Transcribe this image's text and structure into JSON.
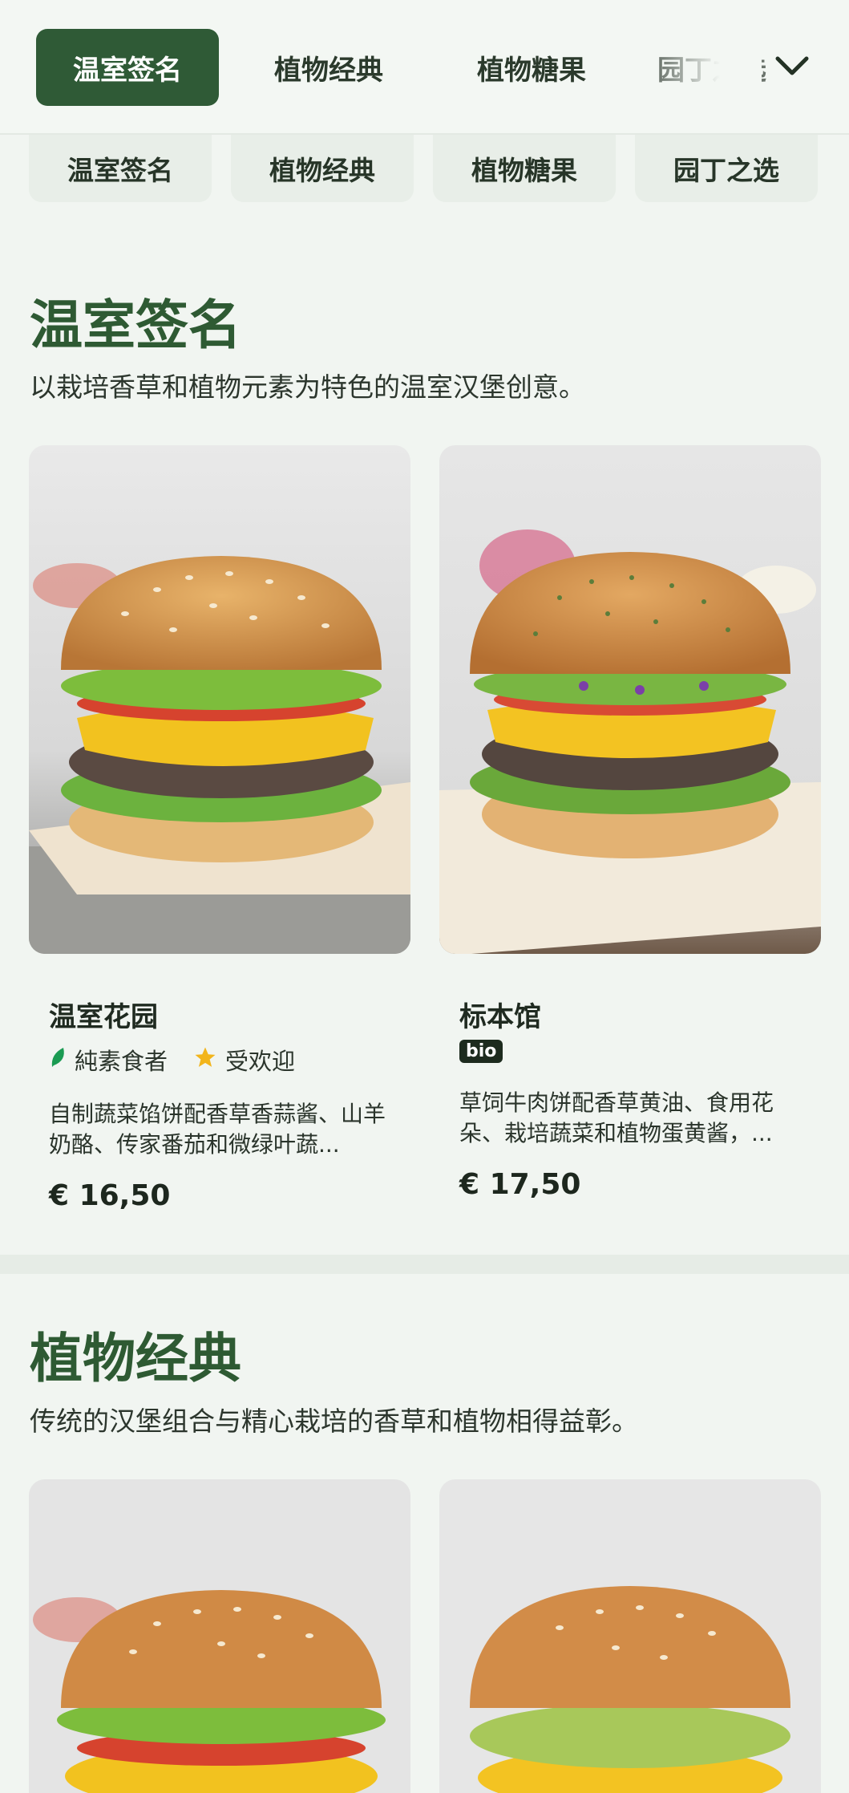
{
  "nav": {
    "tabs": [
      {
        "label": "温室签名",
        "active": true
      },
      {
        "label": "植物经典",
        "active": false
      },
      {
        "label": "植物糖果",
        "active": false
      },
      {
        "label": "园丁之选",
        "active": false
      }
    ],
    "expand_icon": "chevron-down-icon"
  },
  "chips": [
    "温室签名",
    "植物经典",
    "植物糖果",
    "园丁之选"
  ],
  "sections": [
    {
      "title": "温室签名",
      "description": "以栽培香草和植物元素为特色的温室汉堡创意。",
      "items": [
        {
          "name": "温室花园",
          "tags": [
            "純素食者",
            "受欢迎"
          ],
          "description": "自制蔬菜馅饼配香草香蒜酱、山羊奶酪、传家番茄和微绿叶蔬...",
          "price": "€ 16,50"
        },
        {
          "name": "标本馆",
          "badge": "bio",
          "description": "草饲牛肉饼配香草黄油、食用花朵、栽培蔬菜和植物蛋黄酱，...",
          "price": "€ 17,50"
        }
      ]
    },
    {
      "title": "植物经典",
      "description": "传统的汉堡组合与精心栽培的香草和植物相得益彰。"
    }
  ],
  "colors": {
    "brand_green": "#2f5a36",
    "background": "#f1f5f1",
    "vegan_leaf": "#1a9b52",
    "popular_star": "#f2b51c"
  }
}
